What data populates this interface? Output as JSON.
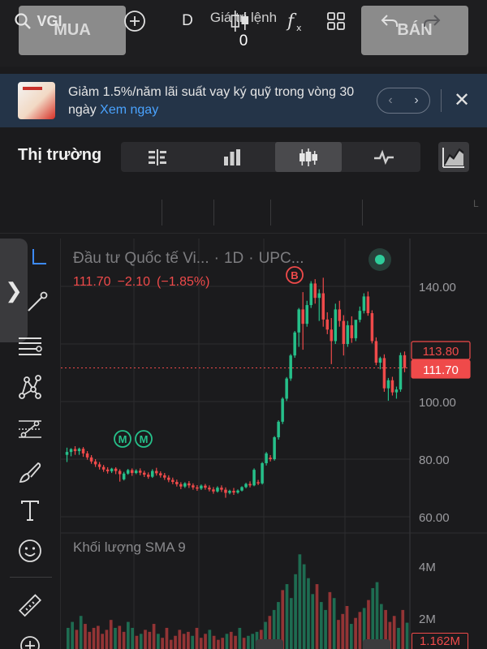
{
  "order_bar": {
    "buy_label": "MUA",
    "sell_label": "BÁN",
    "order_value_label": "Giá trị lệnh",
    "order_value": "0"
  },
  "promo": {
    "text": "Giảm 1.5%/năm lãi suất vay ký quỹ trong vòng 30 ngày",
    "link": "Xem ngay",
    "prev_icon": "chevron-left-icon",
    "next_icon": "chevron-right-icon",
    "close_icon": "close-icon"
  },
  "market": {
    "title": "Thị trường",
    "views": [
      "order-book-icon",
      "bar-chart-icon",
      "candlestick-icon",
      "line-wave-icon"
    ],
    "active_view": "candlestick-icon"
  },
  "toolbar": {
    "symbol": "VGI",
    "interval": "D",
    "undo_icon": "undo-icon",
    "redo_icon": "redo-icon",
    "edge_label": "L"
  },
  "chart": {
    "title_parts": [
      "Đầu tư Quốc tế Vi...",
      "·",
      "1D",
      "·",
      "UPC..."
    ],
    "last_price": "111.70",
    "change": "−2.10",
    "change_pct": "(−1.85%)",
    "badge_current": "113.80",
    "badge_last": "111.70",
    "marker_b": "B",
    "marker_m": "M",
    "colors": {
      "up": "#26c08a",
      "down": "#ef4a4a",
      "background": "#1b1b1d",
      "grid": "#2c2c2f"
    }
  },
  "volume": {
    "title": "Khối lượng SMA 9",
    "tick_4m": "4M",
    "tick_2m": "2M",
    "last_volume": "1.162M"
  },
  "chart_data": {
    "type": "candlestick",
    "interval": "1D",
    "y_ticks": [
      "140.00",
      "100.00",
      "80.00",
      "60.00"
    ],
    "ylim": [
      57,
      146
    ],
    "grid": true,
    "last_close": 111.7,
    "reference_price": 113.8,
    "candles": [
      {
        "o": 81.5,
        "h": 84,
        "c": 82.5,
        "l": 79
      },
      {
        "o": 82.5,
        "h": 83.8,
        "c": 83.5,
        "l": 81
      },
      {
        "o": 83.5,
        "h": 84.5,
        "c": 82.8,
        "l": 81.5
      },
      {
        "o": 82.8,
        "h": 84,
        "c": 83.6,
        "l": 81.5
      },
      {
        "o": 83.6,
        "h": 84.2,
        "c": 82,
        "l": 80.8
      },
      {
        "o": 82,
        "h": 82.8,
        "c": 80.6,
        "l": 79.8
      },
      {
        "o": 80.6,
        "h": 81.4,
        "c": 79.2,
        "l": 78.4
      },
      {
        "o": 79.2,
        "h": 80,
        "c": 78.2,
        "l": 77.3
      },
      {
        "o": 78.2,
        "h": 79,
        "c": 77.3,
        "l": 76.4
      },
      {
        "o": 77.3,
        "h": 78,
        "c": 76.4,
        "l": 75.6
      },
      {
        "o": 76.4,
        "h": 77.2,
        "c": 75.8,
        "l": 75
      },
      {
        "o": 75.8,
        "h": 77,
        "c": 76.7,
        "l": 75.2
      },
      {
        "o": 76.7,
        "h": 77.2,
        "c": 75.9,
        "l": 74.8
      },
      {
        "o": 75.9,
        "h": 76.5,
        "c": 74.8,
        "l": 72.2
      },
      {
        "o": 73,
        "h": 75.6,
        "c": 75,
        "l": 72.6
      },
      {
        "o": 75,
        "h": 76.6,
        "c": 76.2,
        "l": 74.6
      },
      {
        "o": 76.2,
        "h": 76.8,
        "c": 75.2,
        "l": 74.2
      },
      {
        "o": 75.2,
        "h": 76.5,
        "c": 76,
        "l": 74.8
      },
      {
        "o": 76,
        "h": 76.8,
        "c": 75.3,
        "l": 74.4
      },
      {
        "o": 75.3,
        "h": 76,
        "c": 74.6,
        "l": 73.8
      },
      {
        "o": 74.6,
        "h": 75.4,
        "c": 73.9,
        "l": 73.2
      },
      {
        "o": 73.9,
        "h": 76.5,
        "c": 75.9,
        "l": 73.5
      },
      {
        "o": 75.9,
        "h": 77,
        "c": 75.1,
        "l": 74.3
      },
      {
        "o": 75.1,
        "h": 75.8,
        "c": 74.4,
        "l": 73.6
      },
      {
        "o": 74.4,
        "h": 75.2,
        "c": 73.6,
        "l": 72.8
      },
      {
        "o": 73.6,
        "h": 74.4,
        "c": 72.8,
        "l": 72
      },
      {
        "o": 72.8,
        "h": 73.6,
        "c": 72.1,
        "l": 71.3
      },
      {
        "o": 72.1,
        "h": 72.9,
        "c": 71.3,
        "l": 70.5
      },
      {
        "o": 71.3,
        "h": 72,
        "c": 70.5,
        "l": 69.6
      },
      {
        "o": 70.5,
        "h": 72,
        "c": 71.6,
        "l": 70
      },
      {
        "o": 71.6,
        "h": 72.4,
        "c": 70.9,
        "l": 70
      },
      {
        "o": 70.9,
        "h": 71.6,
        "c": 70.2,
        "l": 69.4
      },
      {
        "o": 70.2,
        "h": 71,
        "c": 69.8,
        "l": 69
      },
      {
        "o": 69.8,
        "h": 71.2,
        "c": 70.8,
        "l": 69.3
      },
      {
        "o": 70.8,
        "h": 71.4,
        "c": 70.1,
        "l": 69.4
      },
      {
        "o": 70.1,
        "h": 70.9,
        "c": 69.5,
        "l": 68.8
      },
      {
        "o": 69.5,
        "h": 70.3,
        "c": 68.8,
        "l": 68
      },
      {
        "o": 68.8,
        "h": 70.6,
        "c": 70.1,
        "l": 68.4
      },
      {
        "o": 70.1,
        "h": 70.9,
        "c": 69.4,
        "l": 68.6
      },
      {
        "o": 69.4,
        "h": 70.2,
        "c": 68.3,
        "l": 66.6
      },
      {
        "o": 68.3,
        "h": 69.4,
        "c": 69.0,
        "l": 67.8
      },
      {
        "o": 69.0,
        "h": 70.0,
        "c": 68.4,
        "l": 67.6
      },
      {
        "o": 68.4,
        "h": 69.5,
        "c": 69.1,
        "l": 68.0
      },
      {
        "o": 69.1,
        "h": 70.6,
        "c": 70.3,
        "l": 68.8
      },
      {
        "o": 70.3,
        "h": 71.8,
        "c": 71.4,
        "l": 69.9
      },
      {
        "o": 71.4,
        "h": 72.3,
        "c": 70.9,
        "l": 70.2
      },
      {
        "o": 70.9,
        "h": 76.8,
        "c": 76.3,
        "l": 70.6
      },
      {
        "o": 72,
        "h": 72.8,
        "c": 71.6,
        "l": 71
      },
      {
        "o": 71.6,
        "h": 79,
        "c": 78.6,
        "l": 71.2
      },
      {
        "o": 78.6,
        "h": 82.5,
        "c": 82,
        "l": 77.8
      },
      {
        "o": 80.5,
        "h": 81.4,
        "c": 80,
        "l": 79.2
      },
      {
        "o": 80,
        "h": 88,
        "c": 87.6,
        "l": 79.5
      },
      {
        "o": 87.6,
        "h": 93.5,
        "c": 93,
        "l": 86.8
      },
      {
        "o": 93,
        "h": 101.5,
        "c": 101,
        "l": 92.2
      },
      {
        "o": 101,
        "h": 108.5,
        "c": 108,
        "l": 100.2
      },
      {
        "o": 108,
        "h": 116.5,
        "c": 116,
        "l": 107.2
      },
      {
        "o": 116,
        "h": 124.5,
        "c": 124,
        "l": 115.2
      },
      {
        "o": 124,
        "h": 132.5,
        "c": 132,
        "l": 119
      },
      {
        "o": 132,
        "h": 138,
        "c": 127,
        "l": 118
      },
      {
        "o": 127,
        "h": 135,
        "c": 133.5,
        "l": 126
      },
      {
        "o": 133.5,
        "h": 141.8,
        "c": 141,
        "l": 132.5
      },
      {
        "o": 141,
        "h": 142.5,
        "c": 136,
        "l": 134
      },
      {
        "o": 136,
        "h": 139,
        "c": 137.6,
        "l": 128
      },
      {
        "o": 137.6,
        "h": 143,
        "c": 128.5,
        "l": 126
      },
      {
        "o": 128.5,
        "h": 131,
        "c": 125,
        "l": 123.4
      },
      {
        "o": 125,
        "h": 129,
        "c": 121,
        "l": 113
      },
      {
        "o": 121,
        "h": 134,
        "c": 132,
        "l": 120
      },
      {
        "o": 132,
        "h": 135,
        "c": 128,
        "l": 126
      },
      {
        "o": 128,
        "h": 130,
        "c": 120,
        "l": 116
      },
      {
        "o": 120,
        "h": 128,
        "c": 126.5,
        "l": 119
      },
      {
        "o": 126.5,
        "h": 129.6,
        "c": 122,
        "l": 120.4
      },
      {
        "o": 122,
        "h": 127,
        "c": 128.4,
        "l": 121
      },
      {
        "o": 128.4,
        "h": 133,
        "c": 131.5,
        "l": 127.5
      },
      {
        "o": 131.5,
        "h": 137.6,
        "c": 136.5,
        "l": 130.6
      },
      {
        "o": 136.5,
        "h": 138.2,
        "c": 130.7,
        "l": 129.8
      },
      {
        "o": 130.7,
        "h": 131.7,
        "c": 121,
        "l": 120.2
      },
      {
        "o": 121,
        "h": 122.3,
        "c": 113.5,
        "l": 112.6
      },
      {
        "o": 113.5,
        "h": 115.6,
        "c": 115.1,
        "l": 111.2
      },
      {
        "o": 115.1,
        "h": 116.4,
        "c": 104.6,
        "l": 103.4
      },
      {
        "o": 104.6,
        "h": 108.2,
        "c": 107.4,
        "l": 100.3
      },
      {
        "o": 107.4,
        "h": 108.6,
        "c": 103.2,
        "l": 102.1
      },
      {
        "o": 103.2,
        "h": 105.2,
        "c": 104.2,
        "l": 101
      },
      {
        "o": 104.2,
        "h": 117,
        "c": 116.1,
        "l": 103.4
      },
      {
        "o": 116.1,
        "h": 117.4,
        "c": 111.7,
        "l": 110.2
      }
    ],
    "volume": {
      "ylim": [
        0,
        5
      ],
      "unit": "M",
      "y_ticks": [
        "4M",
        "2M"
      ],
      "values": [
        0.9,
        1.2,
        0.8,
        1.5,
        1.1,
        0.7,
        0.9,
        1.0,
        0.6,
        0.8,
        1.3,
        0.9,
        1.0,
        0.7,
        1.2,
        0.9,
        0.5,
        0.6,
        0.8,
        0.7,
        1.1,
        0.6,
        0.4,
        0.9,
        0.3,
        0.5,
        0.8,
        0.6,
        0.7,
        0.5,
        0.9,
        0.4,
        0.6,
        0.8,
        0.5,
        0.3,
        0.4,
        0.6,
        0.7,
        0.5,
        0.9,
        0.4,
        0.5,
        0.6,
        0.7,
        0.8,
        1.2,
        1.5,
        1.8,
        2.2,
        2.8,
        3.1,
        2.4,
        3.6,
        4.6,
        4.1,
        3.4,
        2.6,
        3.1,
        2.2,
        1.8,
        2.7,
        2.4,
        1.3,
        1.6,
        2.0,
        1.1,
        1.4,
        1.7,
        1.9,
        2.3,
        2.9,
        3.2,
        2.1,
        1.8,
        1.2,
        1.5,
        0.9,
        1.8,
        1.16
      ]
    }
  }
}
